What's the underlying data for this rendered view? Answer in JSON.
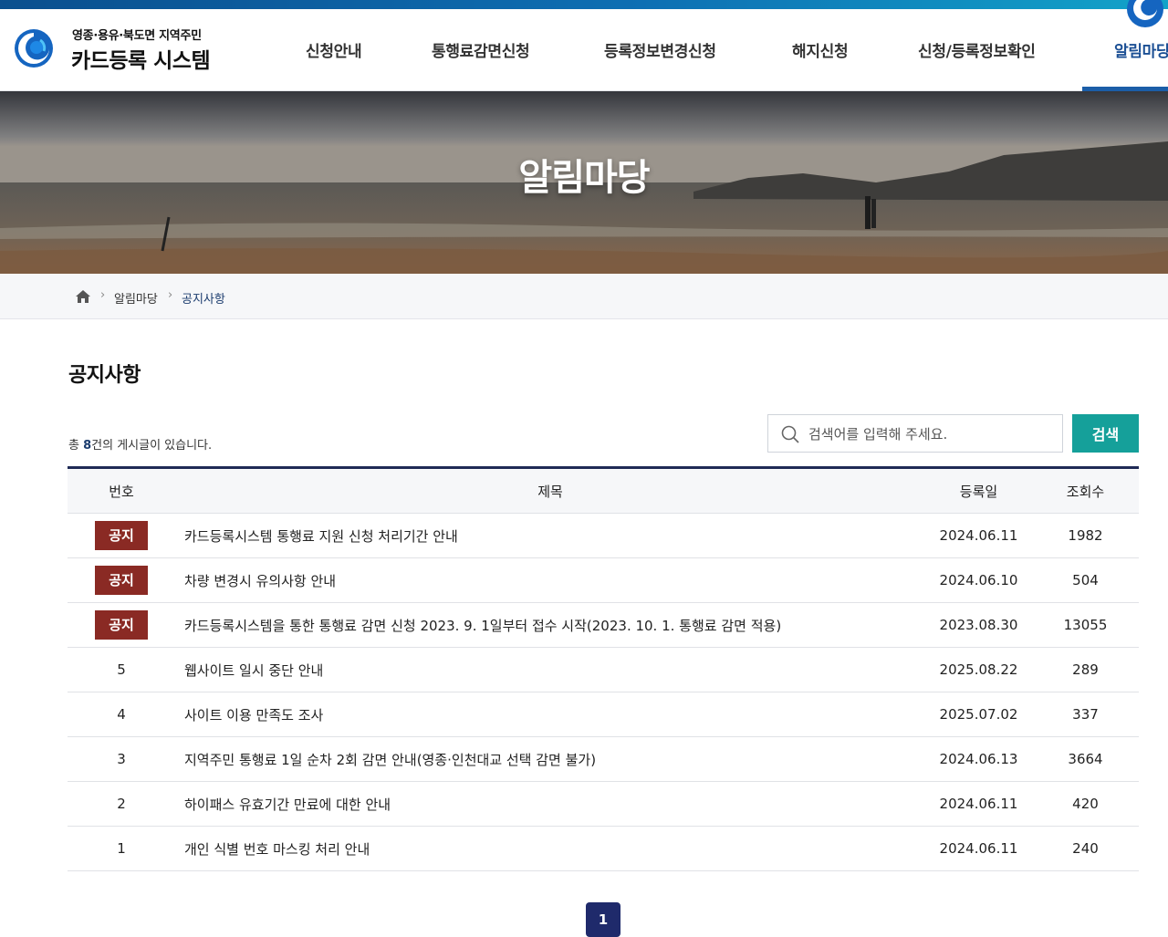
{
  "brand": {
    "subtitle": "영종·용유·북도면 지역주민",
    "title": "카드등록 시스템"
  },
  "nav": {
    "items": [
      {
        "label": "신청안내"
      },
      {
        "label": "통행료감면신청"
      },
      {
        "label": "등록정보변경신청"
      },
      {
        "label": "해지신청"
      },
      {
        "label": "신청/등록정보확인"
      },
      {
        "label": "알림마당",
        "active": true
      }
    ]
  },
  "hero": {
    "title": "알림마당"
  },
  "breadcrumb": {
    "items": [
      "알림마당",
      "공지사항"
    ]
  },
  "page": {
    "title": "공지사항",
    "count_prefix": "총 ",
    "count": "8",
    "count_suffix": "건의 게시글이 있습니다."
  },
  "search": {
    "placeholder": "검색어를 입력해 주세요.",
    "button_label": "검색"
  },
  "table": {
    "headers": [
      "번호",
      "제목",
      "등록일",
      "조회수"
    ],
    "rows": [
      {
        "num": "공지",
        "notice": true,
        "title": "카드등록시스템 통행료 지원 신청 처리기간 안내",
        "date": "2024.06.11",
        "views": "1982"
      },
      {
        "num": "공지",
        "notice": true,
        "title": "차량 변경시 유의사항 안내",
        "date": "2024.06.10",
        "views": "504"
      },
      {
        "num": "공지",
        "notice": true,
        "title": "카드등록시스템을 통한 통행료 감면 신청 2023. 9. 1일부터 접수 시작(2023. 10. 1. 통행료 감면 적용)",
        "date": "2023.08.30",
        "views": "13055"
      },
      {
        "num": "5",
        "notice": false,
        "title": "웹사이트 일시 중단 안내",
        "date": "2025.08.22",
        "views": "289"
      },
      {
        "num": "4",
        "notice": false,
        "title": "사이트 이용 만족도 조사",
        "date": "2025.07.02",
        "views": "337"
      },
      {
        "num": "3",
        "notice": false,
        "title": "지역주민 통행료 1일 순차 2회 감면 안내(영종·인천대교 선택 감면 불가)",
        "date": "2024.06.13",
        "views": "3664"
      },
      {
        "num": "2",
        "notice": false,
        "title": "하이패스 유효기간 만료에 대한 안내",
        "date": "2024.06.11",
        "views": "420"
      },
      {
        "num": "1",
        "notice": false,
        "title": "개인 식별 번호 마스킹 처리 안내",
        "date": "2024.06.11",
        "views": "240"
      }
    ]
  },
  "pagination": {
    "current": "1"
  },
  "colors": {
    "accent": "#1b4f94",
    "search_button": "#15a09a",
    "notice_badge": "#8a2a24",
    "table_top_border": "#1f2a55"
  }
}
